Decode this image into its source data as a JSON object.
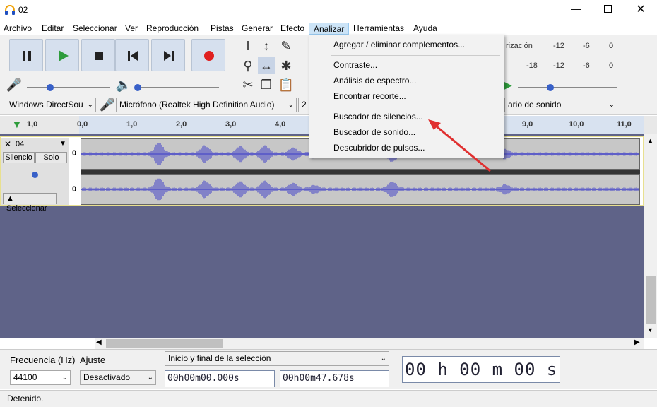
{
  "window": {
    "title": "02"
  },
  "menubar": [
    "Archivo",
    "Editar",
    "Seleccionar",
    "Ver",
    "Reproducción",
    "Pistas",
    "Generar",
    "Efecto",
    "Analizar",
    "Herramientas",
    "Ayuda"
  ],
  "devices": {
    "host": "Windows DirectSou",
    "mic": "Micrófono (Realtek High Definition Audio)",
    "channels": "2 c",
    "output": "ario de sonido"
  },
  "meters": {
    "rec_label": "rización",
    "rec_ticks": [
      "-12",
      "-6",
      "0"
    ],
    "play_ticks": [
      "-18",
      "-12",
      "-6",
      "0"
    ]
  },
  "ruler": {
    "start": "1,0",
    "ticks": [
      "0,0",
      "1,0",
      "2,0",
      "3,0",
      "4,0",
      "9,0",
      "10,0",
      "11,0"
    ]
  },
  "track": {
    "name": "04",
    "mute": "Silencio",
    "solo": "Solo",
    "select": "Seleccionar",
    "scale_top": "0",
    "scale_bottom": "0"
  },
  "dropdown": {
    "items": [
      "Agregar / eliminar complementos...",
      "Contraste...",
      "Análisis de espectro...",
      "Encontrar recorte...",
      "Buscador de silencios...",
      "Buscador de sonido...",
      "Descubridor de pulsos..."
    ]
  },
  "bottom": {
    "rate_label": "Frecuencia (Hz)",
    "rate_value": "44100",
    "snap_label": "Ajuste",
    "snap_value": "Desactivado",
    "sel_label": "Inicio y final de la selección",
    "sel_start": "00h00m00.000s",
    "sel_end": "00h00m47.678s",
    "big_time": "00 h 00 m 00 s"
  },
  "status": "Detenido."
}
